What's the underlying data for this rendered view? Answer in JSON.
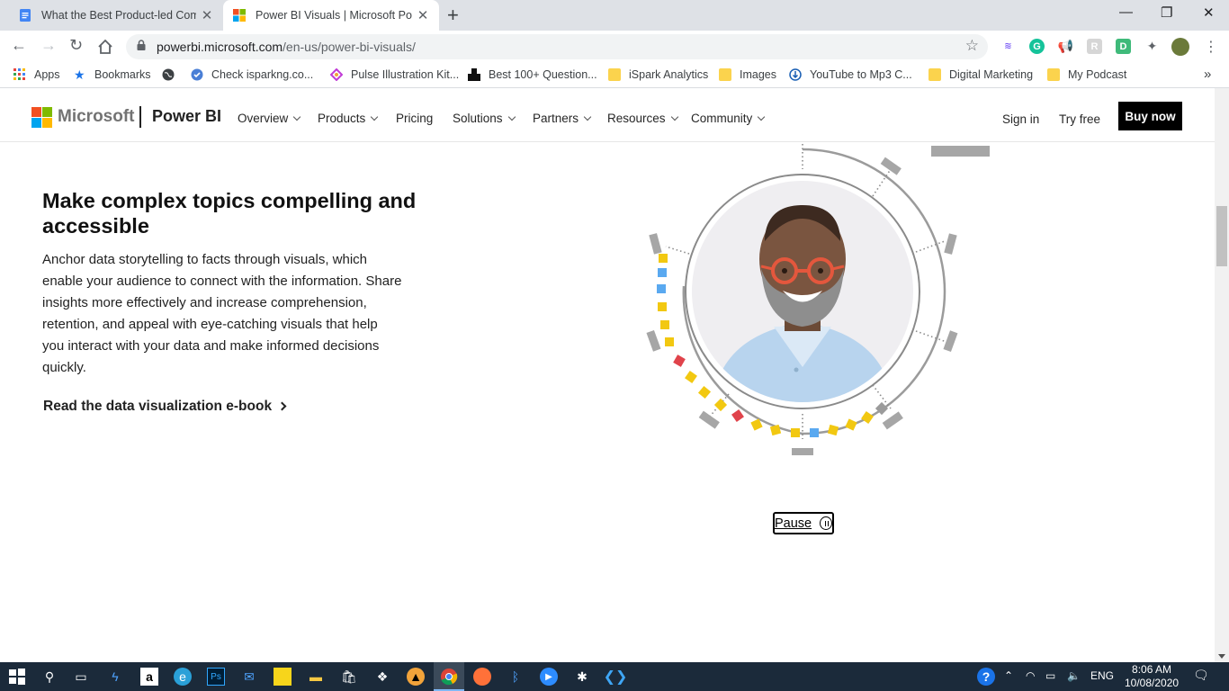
{
  "browser": {
    "tabs": [
      {
        "title": "What the Best Product-led Comp",
        "active": false
      },
      {
        "title": "Power BI Visuals | Microsoft Pow",
        "active": true
      }
    ],
    "url_host": "powerbi.microsoft.com",
    "url_path": "/en-us/power-bi-visuals/",
    "bookmarks": [
      {
        "label": "Apps",
        "icon": "apps-grid-icon"
      },
      {
        "label": "Bookmarks",
        "icon": "star-icon"
      },
      {
        "label": "",
        "icon": "globe-icon"
      },
      {
        "label": "Check isparkng.co...",
        "icon": "check-badge-icon"
      },
      {
        "label": "Pulse Illustration Kit...",
        "icon": "pulse-icon"
      },
      {
        "label": "Best 100+ Question...",
        "icon": "bookmark-page-icon"
      },
      {
        "label": "iSpark Analytics",
        "icon": "folder-icon"
      },
      {
        "label": "Images",
        "icon": "folder-icon"
      },
      {
        "label": "YouTube to Mp3 C...",
        "icon": "download-icon"
      },
      {
        "label": "Digital Marketing",
        "icon": "folder-icon"
      },
      {
        "label": "My Podcast",
        "icon": "folder-icon"
      }
    ],
    "more_bookmarks": "»"
  },
  "site": {
    "brand": "Microsoft",
    "product": "Power BI",
    "nav": [
      "Overview",
      "Products",
      "Pricing",
      "Solutions",
      "Partners",
      "Resources",
      "Community"
    ],
    "nav_dropdown": [
      true,
      true,
      false,
      true,
      true,
      true,
      true
    ],
    "sign_in": "Sign in",
    "try_free": "Try free",
    "buy_now": "Buy now"
  },
  "content": {
    "heading": "Make complex topics compelling and accessible",
    "body": "Anchor data storytelling to facts through visuals, which enable your audience to connect with the information. Share insights more effectively and increase comprehension, retention, and appeal with eye-catching visuals that help you interact with your data and make informed decisions quickly.",
    "ebook_link": "Read the data visualization e-book",
    "pause_label": "Pause"
  },
  "taskbar": {
    "language": "ENG",
    "time": "8:06 AM",
    "date": "10/08/2020"
  },
  "colors": {
    "accent_yellow": "#f2c811",
    "accent_blue": "#5aa9f0",
    "accent_red": "#e0434b",
    "gray_mark": "#a6a6a6",
    "ms_red": "#f25022",
    "ms_green": "#7fba00",
    "ms_blue": "#00a4ef",
    "ms_yellow": "#ffb900"
  }
}
